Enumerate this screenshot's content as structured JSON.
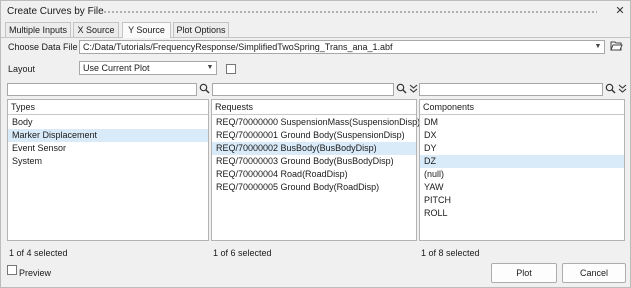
{
  "window": {
    "title": "Create Curves by File",
    "close_glyph": "✕"
  },
  "tabs": [
    {
      "label": "Multiple Inputs",
      "active": false
    },
    {
      "label": "X Source",
      "active": false
    },
    {
      "label": "Y Source",
      "active": true
    },
    {
      "label": "Plot Options",
      "active": false
    }
  ],
  "data_file": {
    "label": "Choose Data File",
    "value": "C:/Data/Tutorials/FrequencyResponse/SimplifiedTwoSpring_Trans_ana_1.abf"
  },
  "layout": {
    "label": "Layout",
    "value": "Use Current Plot",
    "checkbox_checked": false
  },
  "types": {
    "header": "Types",
    "items": [
      "Body",
      "Marker Displacement",
      "Event Sensor",
      "System"
    ],
    "selected_index": 1,
    "status": "1 of 4 selected"
  },
  "requests": {
    "header": "Requests",
    "items": [
      "REQ/70000000 SuspensionMass(SuspensionDisp)",
      "REQ/70000001 Ground Body(SuspensionDisp)",
      "REQ/70000002 BusBody(BusBodyDisp)",
      "REQ/70000003 Ground Body(BusBodyDisp)",
      "REQ/70000004 Road(RoadDisp)",
      "REQ/70000005 Ground Body(RoadDisp)"
    ],
    "selected_index": 2,
    "status": "1 of 6 selected"
  },
  "components": {
    "header": "Components",
    "items": [
      "DM",
      "DX",
      "DY",
      "DZ",
      "(null)",
      "YAW",
      "PITCH",
      "ROLL"
    ],
    "selected_index": 3,
    "status": "1 of 8 selected"
  },
  "footer": {
    "preview_label": "Preview",
    "preview_checked": false,
    "plot_label": "Plot",
    "cancel_label": "Cancel"
  },
  "icons": {
    "dropdown": "chevron-down-icon",
    "folder": "folder-open-icon",
    "search": "search-icon",
    "filter": "double-chevron-down-icon"
  },
  "colors": {
    "selection": "#d9ebf9",
    "background": "#f0f0f0"
  }
}
